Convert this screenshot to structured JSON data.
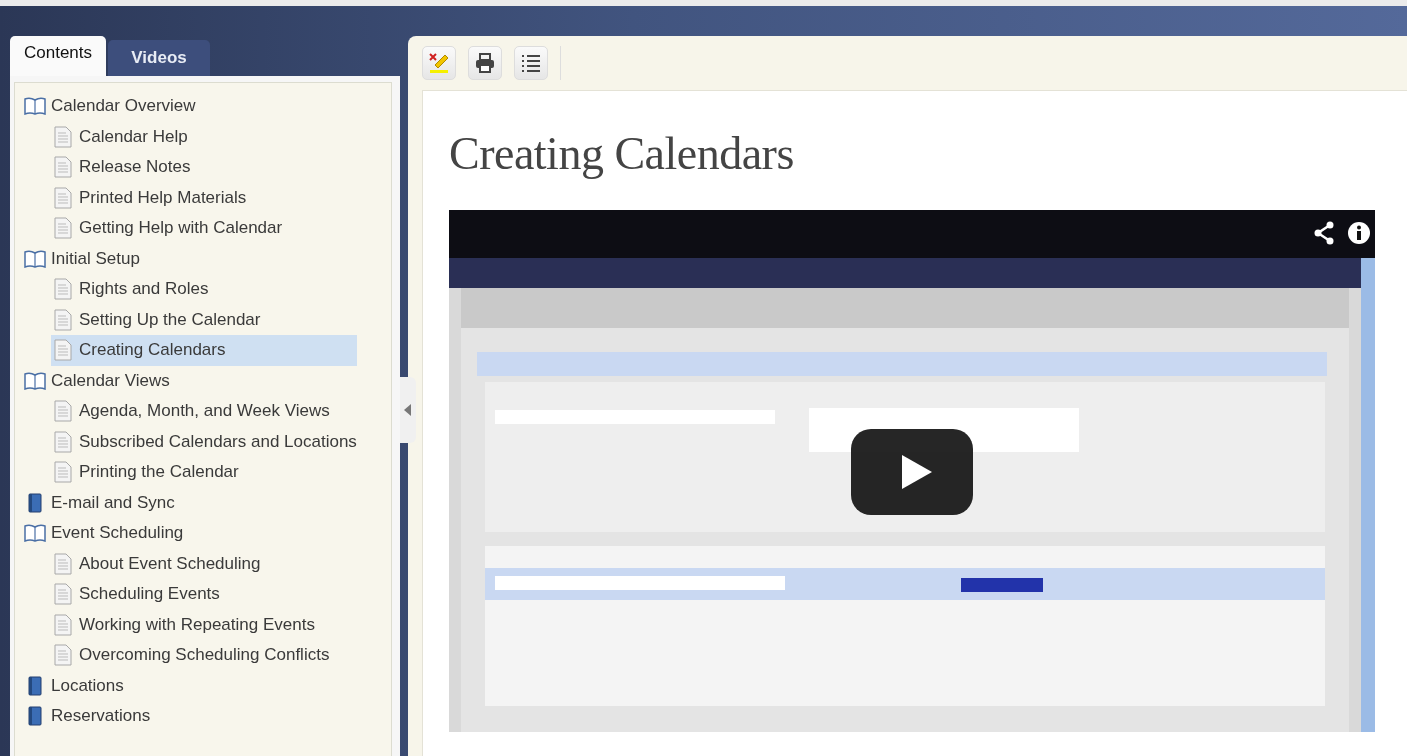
{
  "tabs": [
    {
      "label": "Contents",
      "selected": true
    },
    {
      "label": "Videos",
      "selected": false
    }
  ],
  "tree": [
    {
      "label": "Calendar Overview",
      "kind": "book",
      "expanded": true,
      "selected": false,
      "children": [
        {
          "label": "Calendar Help",
          "kind": "page",
          "selected": false
        },
        {
          "label": "Release Notes",
          "kind": "page",
          "selected": false
        },
        {
          "label": "Printed Help Materials",
          "kind": "page",
          "selected": false
        },
        {
          "label": "Getting Help with Calendar",
          "kind": "page",
          "selected": false
        }
      ]
    },
    {
      "label": "Initial Setup",
      "kind": "book",
      "expanded": true,
      "selected": false,
      "children": [
        {
          "label": "Rights and Roles",
          "kind": "page",
          "selected": false
        },
        {
          "label": "Setting Up the Calendar",
          "kind": "page",
          "selected": false
        },
        {
          "label": "Creating Calendars",
          "kind": "page",
          "selected": true
        }
      ]
    },
    {
      "label": "Calendar Views",
      "kind": "book",
      "expanded": true,
      "selected": false,
      "children": [
        {
          "label": "Agenda, Month, and Week Views",
          "kind": "page",
          "selected": false
        },
        {
          "label": "Subscribed Calendars and Locations",
          "kind": "page",
          "selected": false
        },
        {
          "label": "Printing the Calendar",
          "kind": "page",
          "selected": false
        }
      ]
    },
    {
      "label": "E-mail and Sync",
      "kind": "book",
      "expanded": false,
      "selected": false
    },
    {
      "label": "Event Scheduling",
      "kind": "book",
      "expanded": true,
      "selected": false,
      "children": [
        {
          "label": "About Event Scheduling",
          "kind": "page",
          "selected": false
        },
        {
          "label": "Scheduling Events",
          "kind": "page",
          "selected": false
        },
        {
          "label": "Working with Repeating Events",
          "kind": "page",
          "selected": false
        },
        {
          "label": "Overcoming Scheduling Conflicts",
          "kind": "page",
          "selected": false
        }
      ]
    },
    {
      "label": "Locations",
      "kind": "book",
      "expanded": false,
      "selected": false
    },
    {
      "label": "Reservations",
      "kind": "book",
      "expanded": false,
      "selected": false
    }
  ],
  "article": {
    "title": "Creating Calendars"
  }
}
